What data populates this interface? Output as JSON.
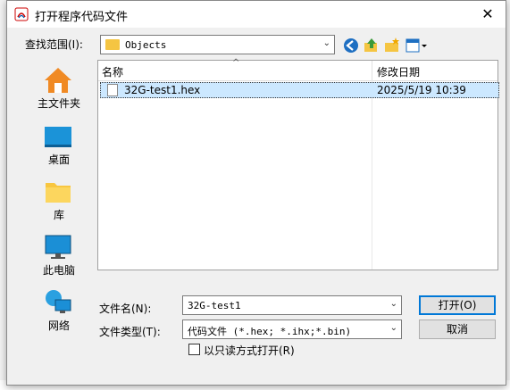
{
  "dialog": {
    "title": "打开程序代码文件",
    "close_glyph": "✕",
    "look_in_label": "查找范围(I):",
    "look_in_value": "Objects",
    "places": [
      {
        "label": "主文件夹",
        "icon": "home-icon"
      },
      {
        "label": "桌面",
        "icon": "desktop-icon"
      },
      {
        "label": "库",
        "icon": "library-folder-icon"
      },
      {
        "label": "此电脑",
        "icon": "computer-icon"
      },
      {
        "label": "网络",
        "icon": "network-icon"
      }
    ],
    "columns": {
      "name": "名称",
      "date": "修改日期"
    },
    "files": [
      {
        "name": "32G-test1.hex",
        "date": "2025/5/19 10:39",
        "selected": true
      }
    ],
    "filename_label": "文件名(N):",
    "filename_value": "32G-test1",
    "filetype_label": "文件类型(T):",
    "filetype_value": "代码文件 (*.hex; *.ihx;*.bin)",
    "readonly_label": "以只读方式打开(R)",
    "open_button": "打开(O)",
    "cancel_button": "取消",
    "toolbar_icons": [
      "back-icon",
      "up-folder-icon",
      "new-folder-icon",
      "view-menu-icon"
    ]
  },
  "colors": {
    "selection": "#cce8ff",
    "accent": "#0078d7"
  }
}
